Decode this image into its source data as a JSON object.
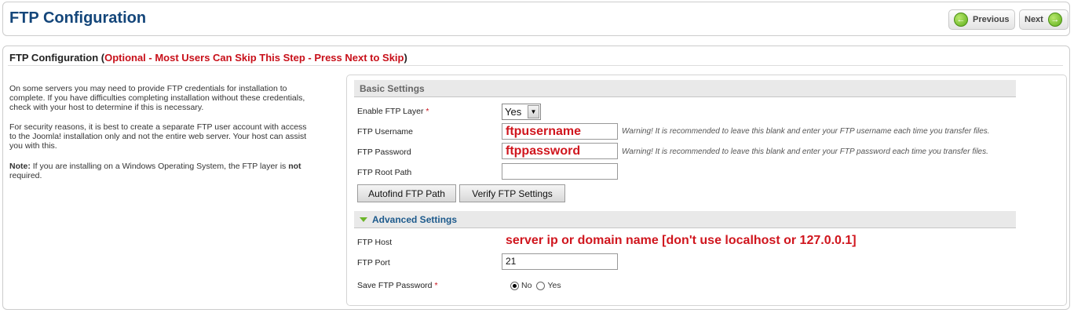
{
  "header": {
    "title": "FTP Configuration",
    "previous_label": "Previous",
    "next_label": "Next"
  },
  "section": {
    "title": "FTP Configuration (",
    "optional_note": "Optional - Most Users Can Skip This Step - Press Next to Skip",
    "title_end": ")"
  },
  "info": {
    "p1": "On some servers you may need to provide FTP credentials for installation to complete. If you have difficulties completing installation without these credentials, check with your host to determine if this is necessary.",
    "p2": "For security reasons, it is best to create a separate FTP user account with access to the Joomla! installation only and not the entire web server. Your host can assist you with this.",
    "p3_prefix": "Note:",
    "p3_mid": " If you are installing on a Windows Operating System, the FTP layer is ",
    "p3_bold": "not",
    "p3_suffix": " required."
  },
  "basic": {
    "header": "Basic Settings",
    "enable_label": "Enable FTP Layer",
    "required_mark": "*",
    "enable_value": "Yes",
    "username_label": "FTP Username",
    "username_value": "ftpusername",
    "username_warning": "Warning! It is recommended to leave this blank and enter your FTP username each time you transfer files.",
    "password_label": "FTP Password",
    "password_value": "ftppassword",
    "password_warning": "Warning! It is recommended to leave this blank and enter your FTP password each time you transfer files.",
    "root_label": "FTP Root Path",
    "root_value": "",
    "autofind_label": "Autofind FTP Path",
    "verify_label": "Verify FTP Settings"
  },
  "advanced": {
    "header": "Advanced Settings",
    "host_label": "FTP Host",
    "host_value": "server ip or domain name [don't use localhost or 127.0.0.1]",
    "port_label": "FTP Port",
    "port_value": "21",
    "save_label": "Save FTP Password",
    "required_mark": "*",
    "no_label": "No",
    "yes_label": "Yes",
    "save_selected": "No"
  },
  "colors": {
    "title_blue": "#14467a",
    "required_red": "#c8101a",
    "accent_green": "#5fae1c"
  }
}
